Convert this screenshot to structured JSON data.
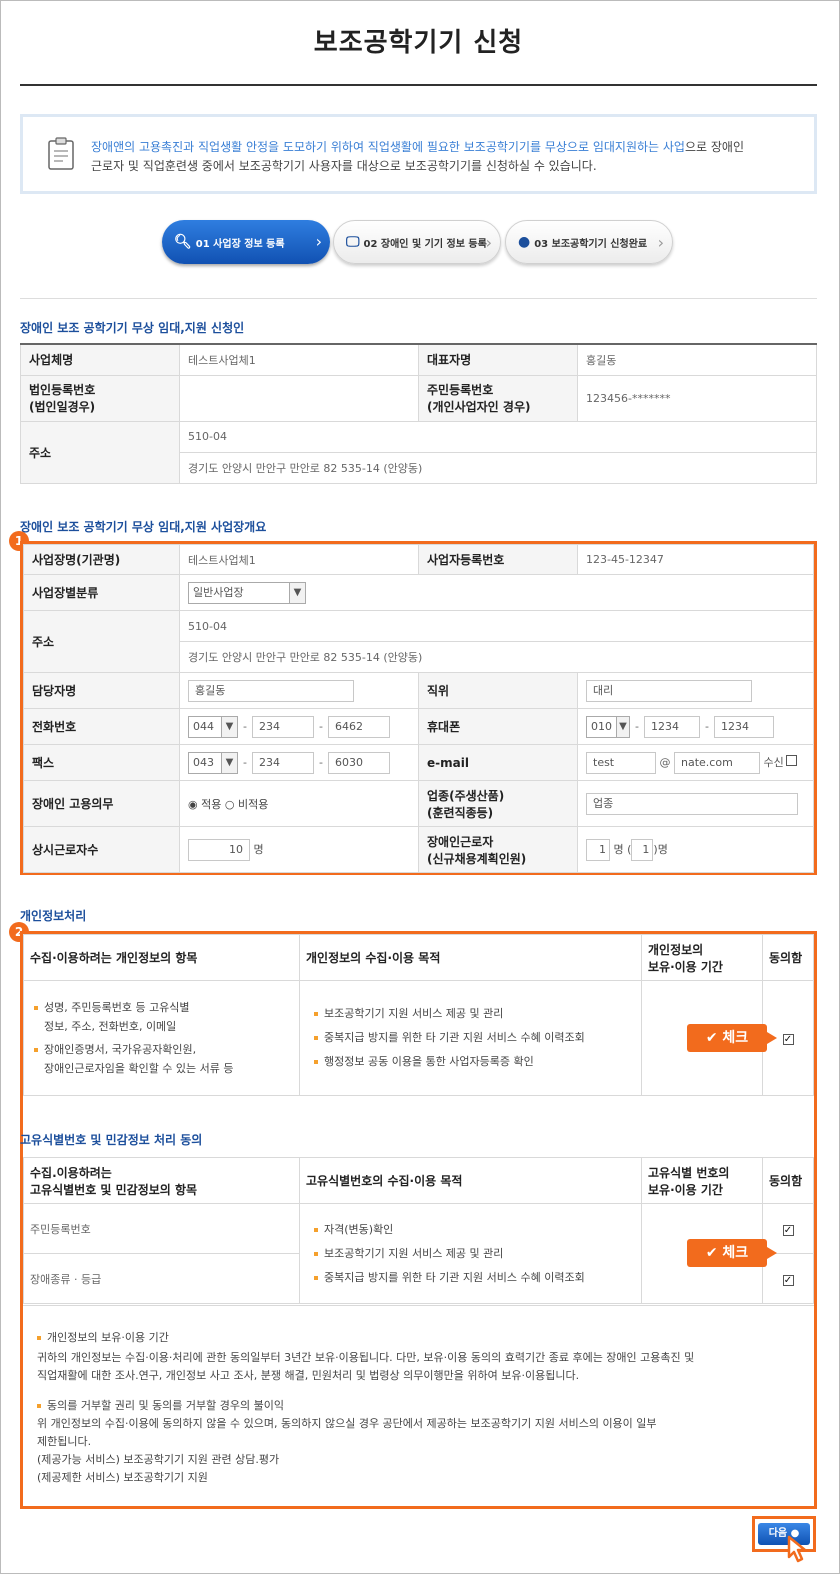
{
  "page": {
    "title": "보조공학기기 신청"
  },
  "notice": {
    "highlight": "장애앤의 고용촉진과 직업생활 안정을 도모하기 위하여 직업생활에 필요한 보조공학기기를 무상으로 임대지원하는 사업",
    "rest1": "으로 장애인",
    "line2": "근로자 및 직업훈련생 중에서 보조공학기기 사용자를 대상으로 보조공학기기를 신청하실 수 있습니다."
  },
  "steps": [
    {
      "label": "01 사업장 정보 등록"
    },
    {
      "label": "02 장애인 및 기기 정보 등록"
    },
    {
      "label": "03 보조공학기기 신청완료"
    }
  ],
  "applicant": {
    "section_title": "장애인 보조 공학기기 무상 임대,지원 신청인",
    "biz_name_label": "사업체명",
    "biz_name": "테스트사업체1",
    "rep_label": "대표자명",
    "rep": "홍길동",
    "corp_no_label": "법인등록번호",
    "corp_no_label2": "(법인일경우)",
    "rrn_label": "주민등록번호",
    "rrn_label2": "(개인사업자인 경우)",
    "rrn": "123456-*******",
    "addr_label": "주소",
    "zip": "510-04",
    "addr": "경기도 안양시 만안구 만안로 82 535-14 (안양동)"
  },
  "workplace": {
    "section_title": "장애인 보조 공학기기 무상 임대,지원 사업장개요",
    "badge": "1",
    "name_label": "사업장명(기관명)",
    "name": "테스트사업체1",
    "bizno_label": "사업자등록번호",
    "bizno": "123-45-12347",
    "type_label": "사업장별분류",
    "type": "일반사업장",
    "addr_label": "주소",
    "zip": "510-04",
    "addr": "경기도 안양시 만안구 만안로 82 535-14 (안양동)",
    "manager_label": "담당자명",
    "manager": "홍길동",
    "position_label": "직위",
    "position": "대리",
    "phone_label": "전화번호",
    "phone1": "044",
    "phone2": "234",
    "phone3": "6462",
    "mobile_label": "휴대폰",
    "mobile1": "010",
    "mobile2": "1234",
    "mobile3": "1234",
    "fax_label": "팩스",
    "fax1": "043",
    "fax2": "234",
    "fax3": "6030",
    "email_label": "e-mail",
    "email_user": "test",
    "email_at": "@",
    "email_domain": "nate.com",
    "email_recv": "수신",
    "duty_label": "장애인 고용의무",
    "duty_yes": "적용",
    "duty_no": "비적용",
    "industry_label": "업종(주생산품)",
    "industry_label2": "(훈련직종등)",
    "industry": "업종",
    "workers_label": "상시근로자수",
    "workers": "10",
    "unit": "명",
    "dis_workers_label": "장애인근로자",
    "dis_workers_label2": "(신규채용계획인원)",
    "dis_workers": "1",
    "dis_plan": "1"
  },
  "privacy": {
    "section_title": "개인정보처리",
    "badge": "2",
    "col1": "수집·이용하려는 개인정보의 항목",
    "col2": "개인정보의 수집·이용 목적",
    "col3a": "개인정보의",
    "col3b": "보유·이용 기간",
    "col4": "동의함",
    "items": [
      "성명, 주민등록번호 등 고유식별",
      "정보, 주소, 전화번호, 이메일",
      "장애인증명서, 국가유공자확인원,",
      "장애인근로자임을 확인할 수 있는 서류 등"
    ],
    "purposes": [
      "보조공학기기 지원 서비스 제공 및 관리",
      "중복지급 방지를 위한 타 기관 지원 서비스 수혜 이력조회",
      "행정정보 공동 이용을 통한 사업자등록증 확인"
    ],
    "callout": "체크"
  },
  "unique": {
    "section_title": "고유식별번호 및 민감정보 처리 동의",
    "col1a": "수집.이용하려는",
    "col1b": "고유식별번호 및 민감정보의 항목",
    "col2": "고유식별번호의 수집·이용 목적",
    "col3a": "고유식별 번호의",
    "col3b": "보유·이용 기간",
    "col4": "동의함",
    "row1": "주민등록번호",
    "row2": "장애종류 · 등급",
    "purposes": [
      "자격(변동)확인",
      "보조공학기기 지원 서비스 제공 및 관리",
      "중복지급 방지를 위한 타 기관 지원 서비스 수혜 이력조회"
    ],
    "callout": "체크"
  },
  "notes": {
    "h1": "개인정보의 보유·이용 기간",
    "p1a": "귀하의 개인정보는 수집·이용·처리에 관한 동의일부터 3년간 보유·이용됩니다. 다만, 보유·이용 동의의 효력기간 종료 후에는 장애인 고용촉진 및",
    "p1b": "직업재활에 대한 조사.연구, 개인정보 사고 조사, 분쟁 해결, 민원처리 및 법령상 의무이행만을 위하여 보유·이용됩니다.",
    "h2": "동의를 거부할 권리 및 동의를 거부할 경우의 불이익",
    "p2a": "위 개인정보의 수집·이용에 동의하지 않을 수 있으며, 동의하지 않으실 경우 공단에서 제공하는 보조공학기기 지원 서비스의 이용이 일부",
    "p2b": "제한됩니다.",
    "p2c": "(제공가능 서비스) 보조공학기기 지원 관련 상담.평가",
    "p2d": "(제공제한 서비스) 보조공학기기 지원"
  },
  "next": {
    "label": "다음"
  }
}
